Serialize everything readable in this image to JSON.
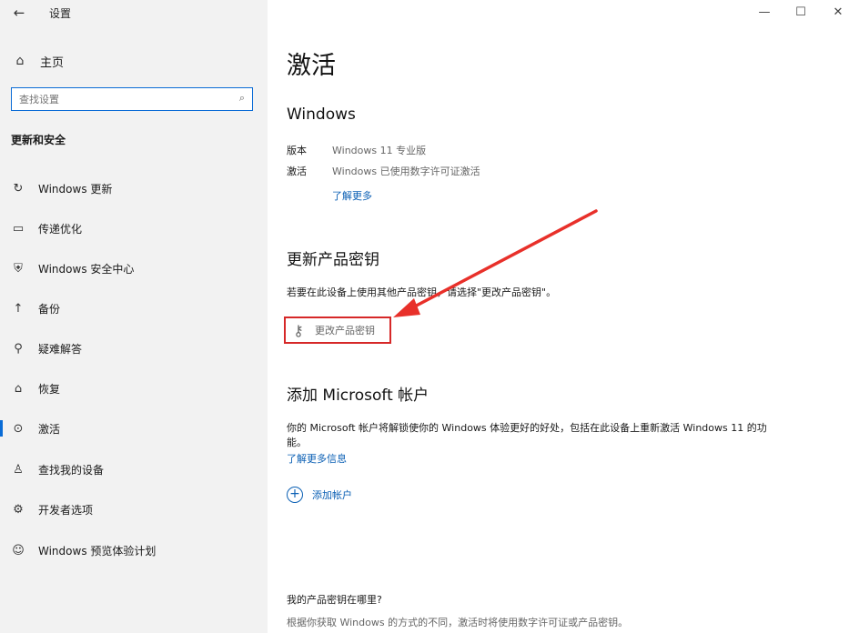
{
  "window": {
    "title": "设置",
    "back_icon": "arrow-left-icon",
    "minimize_glyph": "—",
    "maximize_glyph": "☐",
    "close_glyph": "✕"
  },
  "sidebar": {
    "home_label": "主页",
    "search_placeholder": "查找设置",
    "section_title": "更新和安全",
    "items": [
      {
        "label": "Windows 更新",
        "icon": "refresh-icon"
      },
      {
        "label": "传递优化",
        "icon": "delivery-optimization-icon"
      },
      {
        "label": "Windows 安全中心",
        "icon": "shield-icon"
      },
      {
        "label": "备份",
        "icon": "backup-arrow-icon"
      },
      {
        "label": "疑难解答",
        "icon": "wrench-icon"
      },
      {
        "label": "恢复",
        "icon": "recovery-icon"
      },
      {
        "label": "激活",
        "icon": "check-circle-icon"
      },
      {
        "label": "查找我的设备",
        "icon": "person-location-icon"
      },
      {
        "label": "开发者选项",
        "icon": "developer-tools-icon"
      },
      {
        "label": "Windows 预览体验计划",
        "icon": "insider-icon"
      }
    ],
    "active_index": 6
  },
  "main": {
    "page_title": "激活",
    "windows_section": {
      "heading": "Windows",
      "edition_key": "版本",
      "edition_value": "Windows 11 专业版",
      "activation_key": "激活",
      "activation_value": "Windows 已使用数字许可证激活",
      "learn_more": "了解更多"
    },
    "update_key_section": {
      "heading": "更新产品密钥",
      "description": "若要在此设备上使用其他产品密钥，请选择\"更改产品密钥\"。",
      "change_key_label": "更改产品密钥"
    },
    "account_section": {
      "heading": "添加 Microsoft 帐户",
      "description_line1": "你的 Microsoft 帐户将解锁使你的 Windows 体验更好的好处，包括在此设备上重新激活 Windows 11 的功",
      "description_line2": "能。",
      "learn_more": "了解更多信息",
      "add_account_label": "添加帐户"
    },
    "where_key_section": {
      "heading": "我的产品密钥在哪里?",
      "description": "根据你获取 Windows 的方式的不同，激活时将使用数字许可证或产品密钥。"
    }
  },
  "annotation": {
    "arrow_color": "#e8302a",
    "highlight_color": "#d62828"
  }
}
